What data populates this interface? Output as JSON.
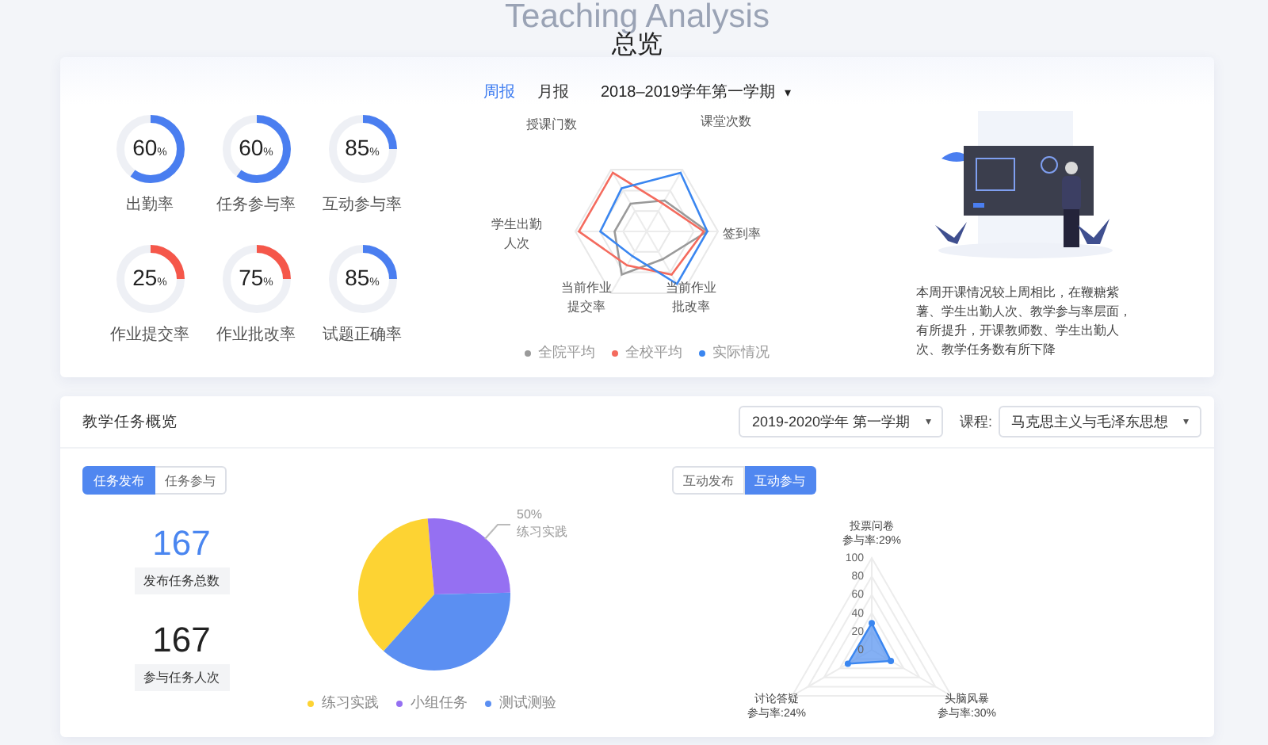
{
  "backdrop_title": "Teaching Analysis",
  "title": "总览",
  "overview": {
    "tabs": [
      {
        "label": "周报",
        "selected": true
      },
      {
        "label": "月报",
        "selected": false
      }
    ],
    "term_select": {
      "value": "2018–2019学年第一学期",
      "caret": "▾"
    },
    "rates": [
      {
        "value": "60",
        "unit": "%",
        "label": "出勤率",
        "level": 0.6,
        "color": "#4a7ef0"
      },
      {
        "value": "60",
        "unit": "%",
        "label": "任务参与率",
        "level": 0.6,
        "color": "#4a7ef0"
      },
      {
        "value": "85",
        "unit": "%",
        "label": "互动参与率",
        "level": 0.25,
        "color": "#4a7ef0"
      },
      {
        "value": "25",
        "unit": "%",
        "label": "作业提交率",
        "level": 0.25,
        "color": "#f5574a"
      },
      {
        "value": "75",
        "unit": "%",
        "label": "作业批改率",
        "level": 0.25,
        "color": "#f5574a"
      },
      {
        "value": "85",
        "unit": "%",
        "label": "试题正确率",
        "level": 0.25,
        "color": "#4a7ef0"
      }
    ],
    "radar": {
      "axes": [
        [
          "授课门数"
        ],
        [
          "课堂次数"
        ],
        [
          "学生出勤",
          "人次"
        ],
        [
          "签到率"
        ],
        [
          "当前作业",
          "提交率"
        ],
        [
          "当前作业",
          "批改率"
        ]
      ],
      "legend": [
        {
          "label": "全院平均",
          "color": "#9a9a9a"
        },
        {
          "label": "全校平均",
          "color": "#f46b5e"
        },
        {
          "label": "实际情况",
          "color": "#3a86f0"
        }
      ]
    },
    "summary": "本周开课情况较上周相比，在鞭糖紫薯、学生出勤人次、教学参与率层面，有所提升，开课教师数、学生出勤人次、教学任务数有所下降"
  },
  "tasks": {
    "title": "教学任务概览",
    "term_select": {
      "value": "2019-2020学年  第一学期",
      "caret": "▾"
    },
    "course_label": "课程:",
    "course_select": {
      "value": "马克思主义与毛泽东思想",
      "caret": "▾"
    },
    "task_tabs": [
      {
        "label": "任务发布",
        "selected": true
      },
      {
        "label": "任务参与",
        "selected": false
      }
    ],
    "stats": [
      {
        "value": "167",
        "label": "发布任务总数",
        "kind": "accent"
      },
      {
        "value": "167",
        "label": "参与任务人次",
        "kind": "plain"
      }
    ],
    "chart_data": {
      "type": "pie",
      "categories": [
        "练习实践",
        "小组任务",
        "测试测验"
      ],
      "values": [
        37,
        26,
        37
      ],
      "colors": [
        "#fdd333",
        "#9570f2",
        "#5b8ff2"
      ],
      "legend": "bottom",
      "annotations": [
        {
          "text": "50%"
        },
        {
          "text": "练习实践"
        }
      ]
    },
    "interact_tabs": [
      {
        "label": "互动发布",
        "selected": false
      },
      {
        "label": "互动参与",
        "selected": true
      }
    ],
    "interact_radar": {
      "ticks": [
        "100",
        "80",
        "60",
        "40",
        "20",
        "0"
      ],
      "axes": [
        {
          "name": "投票问卷",
          "reading": "参与率:29%"
        },
        {
          "name": "讨论答疑",
          "reading": "参与率:24%"
        },
        {
          "name": "头脑风暴",
          "reading": "参与率:30%"
        }
      ]
    }
  }
}
